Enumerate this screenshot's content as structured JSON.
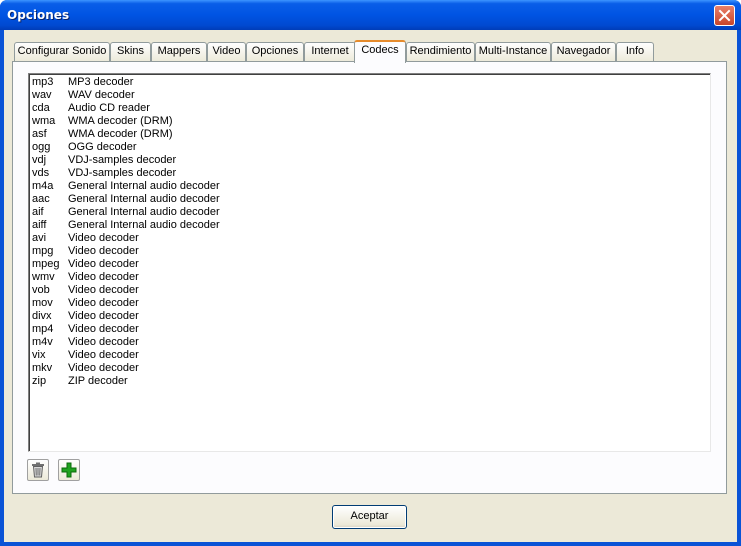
{
  "window": {
    "title": "Opciones"
  },
  "tabs": [
    {
      "label": "Configurar Sonido",
      "active": false
    },
    {
      "label": "Skins",
      "active": false
    },
    {
      "label": "Mappers",
      "active": false
    },
    {
      "label": "Video",
      "active": false
    },
    {
      "label": "Opciones",
      "active": false
    },
    {
      "label": "Internet",
      "active": false
    },
    {
      "label": "Codecs",
      "active": true
    },
    {
      "label": "Rendimiento",
      "active": false
    },
    {
      "label": "Multi-Instance",
      "active": false
    },
    {
      "label": "Navegador",
      "active": false
    },
    {
      "label": "Info",
      "active": false
    }
  ],
  "codecs": [
    {
      "ext": "mp3",
      "desc": "MP3 decoder"
    },
    {
      "ext": "wav",
      "desc": "WAV decoder"
    },
    {
      "ext": "cda",
      "desc": "Audio CD reader"
    },
    {
      "ext": "wma",
      "desc": "WMA decoder (DRM)"
    },
    {
      "ext": "asf",
      "desc": "WMA decoder (DRM)"
    },
    {
      "ext": "ogg",
      "desc": "OGG decoder"
    },
    {
      "ext": "vdj",
      "desc": "VDJ-samples decoder"
    },
    {
      "ext": "vds",
      "desc": "VDJ-samples decoder"
    },
    {
      "ext": "m4a",
      "desc": "General Internal audio decoder"
    },
    {
      "ext": "aac",
      "desc": "General Internal audio decoder"
    },
    {
      "ext": "aif",
      "desc": "General Internal audio decoder"
    },
    {
      "ext": "aiff",
      "desc": "General Internal audio decoder"
    },
    {
      "ext": "avi",
      "desc": "Video decoder"
    },
    {
      "ext": "mpg",
      "desc": "Video decoder"
    },
    {
      "ext": "mpeg",
      "desc": "Video decoder"
    },
    {
      "ext": "wmv",
      "desc": "Video decoder"
    },
    {
      "ext": "vob",
      "desc": "Video decoder"
    },
    {
      "ext": "mov",
      "desc": "Video decoder"
    },
    {
      "ext": "divx",
      "desc": "Video decoder"
    },
    {
      "ext": "mp4",
      "desc": "Video decoder"
    },
    {
      "ext": "m4v",
      "desc": "Video decoder"
    },
    {
      "ext": "vix",
      "desc": "Video decoder"
    },
    {
      "ext": "mkv",
      "desc": "Video decoder"
    },
    {
      "ext": "zip",
      "desc": "ZIP decoder"
    }
  ],
  "toolbar": {
    "delete_icon": "trash-icon",
    "add_icon": "plus-icon",
    "add_color": "#1fa21f"
  },
  "footer": {
    "accept_label": "Aceptar"
  },
  "colors": {
    "titlebar": "#0054e3",
    "dialog_face": "#ece9d8",
    "active_tab_accent": "#e68b2c"
  }
}
